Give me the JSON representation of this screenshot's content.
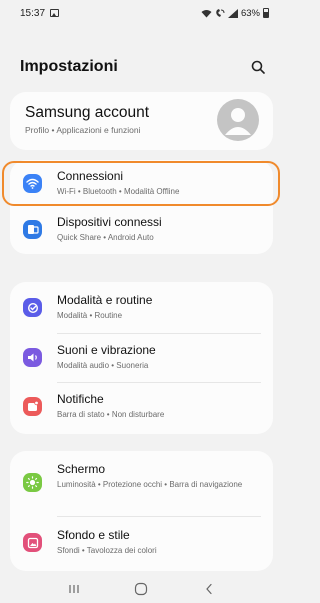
{
  "status_bar": {
    "time": "15:37",
    "battery": "63%"
  },
  "header": {
    "title": "Impostazioni",
    "search_icon": "search-icon"
  },
  "account": {
    "title": "Samsung account",
    "subtitle": "Profilo • Applicazioni e funzioni",
    "avatar_icon": "person-icon"
  },
  "groups": [
    {
      "items": [
        {
          "title": "Connessioni",
          "subtitle": "Wi-Fi • Bluetooth • Modalità Offline",
          "icon": "wifi-icon",
          "color": "#3b82f6",
          "highlighted": true
        },
        {
          "title": "Dispositivi connessi",
          "subtitle": "Quick Share • Android Auto",
          "icon": "devices-icon",
          "color": "#2f7ae5"
        }
      ]
    },
    {
      "items": [
        {
          "title": "Modalità e routine",
          "subtitle": "Modalità • Routine",
          "icon": "routine-icon",
          "color": "#5a5ce8"
        },
        {
          "title": "Suoni e vibrazione",
          "subtitle": "Modalità audio • Suoneria",
          "icon": "sound-icon",
          "color": "#7b5ae0"
        },
        {
          "title": "Notifiche",
          "subtitle": "Barra di stato • Non disturbare",
          "icon": "notification-icon",
          "color": "#ec5a5a"
        }
      ]
    },
    {
      "items": [
        {
          "title": "Schermo",
          "subtitle": "Luminosità • Protezione occhi • Barra di navigazione",
          "icon": "brightness-icon",
          "color": "#7ac943"
        },
        {
          "title": "Sfondo e stile",
          "subtitle": "Sfondi • Tavolozza dei colori",
          "icon": "wallpaper-icon",
          "color": "#e2507a"
        }
      ]
    }
  ],
  "nav": {
    "recents_icon": "recents-icon",
    "home_icon": "home-icon",
    "back_icon": "back-icon"
  }
}
